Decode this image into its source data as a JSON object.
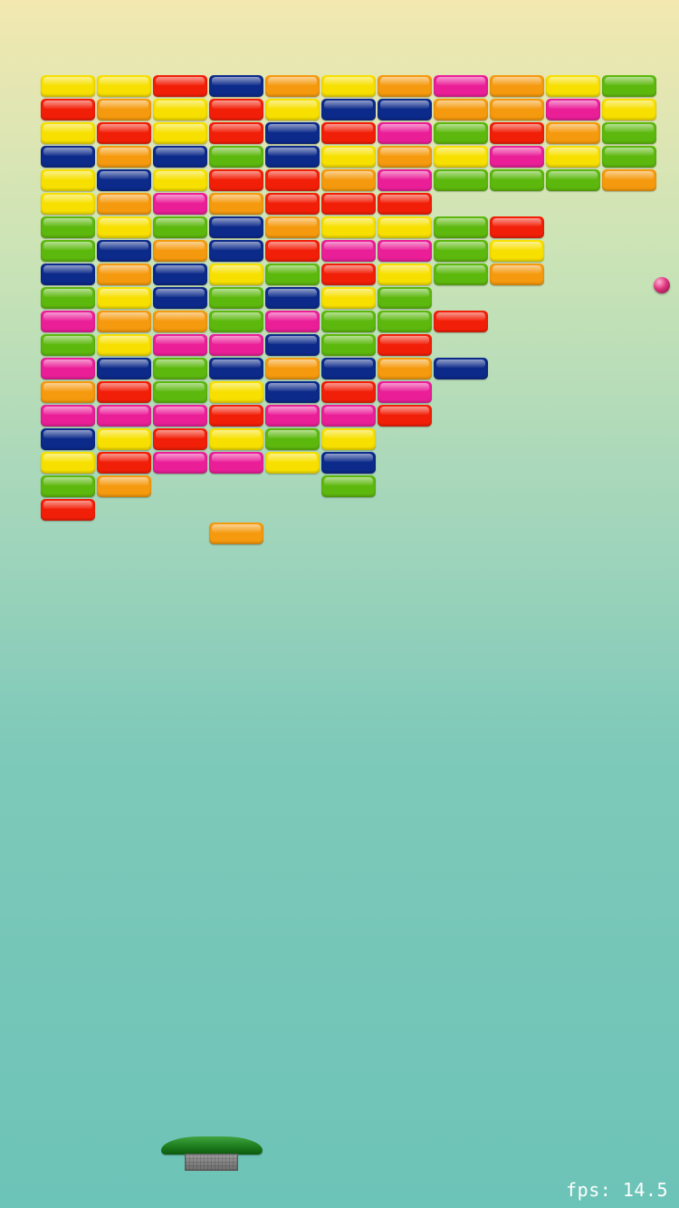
{
  "colors": {
    "yellow": "#f7e000",
    "orange": "#f59a0e",
    "red": "#f21f08",
    "navy": "#0c2a8a",
    "magenta": "#ea1f98",
    "green": "#5db80e"
  },
  "ball": {
    "color": "#e0357e",
    "icon": "ball-icon"
  },
  "paddle": {
    "color": "#1d7d1d",
    "icon": "paddle-icon"
  },
  "hud": {
    "fps_text": "fps: 14.5"
  },
  "bricks": {
    "columns": 11,
    "rows": [
      [
        "yellow",
        "yellow",
        "red",
        "navy",
        "orange",
        "yellow",
        "orange",
        "magenta",
        "orange",
        "yellow",
        "green"
      ],
      [
        "red",
        "orange",
        "yellow",
        "red",
        "yellow",
        "navy",
        "navy",
        "orange",
        "orange",
        "magenta",
        "yellow"
      ],
      [
        "yellow",
        "red",
        "yellow",
        "red",
        "navy",
        "red",
        "magenta",
        "green",
        "red",
        "orange",
        "green"
      ],
      [
        "navy",
        "orange",
        "navy",
        "green",
        "navy",
        "yellow",
        "orange",
        "yellow",
        "magenta",
        "yellow",
        "green"
      ],
      [
        "yellow",
        "navy",
        "yellow",
        "red",
        "red",
        "orange",
        "magenta",
        "green",
        "green",
        "green",
        "orange"
      ],
      [
        "yellow",
        "orange",
        "magenta",
        "orange",
        "red",
        "red",
        "red",
        null,
        null,
        null,
        null
      ],
      [
        "green",
        "yellow",
        "green",
        "navy",
        "orange",
        "yellow",
        "yellow",
        "green",
        "red",
        null,
        null
      ],
      [
        "green",
        "navy",
        "orange",
        "navy",
        "red",
        "magenta",
        "magenta",
        "green",
        "yellow",
        null,
        null
      ],
      [
        "navy",
        "orange",
        "navy",
        "yellow",
        "green",
        "red",
        "yellow",
        "green",
        "orange",
        null,
        null
      ],
      [
        "green",
        "yellow",
        "navy",
        "green",
        "navy",
        "yellow",
        "green",
        null,
        null,
        null,
        null
      ],
      [
        "magenta",
        "orange",
        "orange",
        "green",
        "magenta",
        "green",
        "green",
        "red",
        null,
        null,
        null
      ],
      [
        "green",
        "yellow",
        "magenta",
        "magenta",
        "navy",
        "green",
        "red",
        null,
        null,
        null,
        null
      ],
      [
        "magenta",
        "navy",
        "green",
        "navy",
        "orange",
        "navy",
        "orange",
        "navy",
        null,
        null,
        null
      ],
      [
        "orange",
        "red",
        "green",
        "yellow",
        "navy",
        "red",
        "magenta",
        null,
        null,
        null,
        null
      ],
      [
        "magenta",
        "magenta",
        "magenta",
        "red",
        "magenta",
        "magenta",
        "red",
        null,
        null,
        null,
        null
      ],
      [
        "navy",
        "yellow",
        "red",
        "yellow",
        "green",
        "yellow",
        null,
        null,
        null,
        null,
        null
      ],
      [
        "yellow",
        "red",
        "magenta",
        "magenta",
        "yellow",
        "navy",
        null,
        null,
        null,
        null,
        null
      ],
      [
        "green",
        "orange",
        null,
        null,
        null,
        "green",
        null,
        null,
        null,
        null,
        null
      ],
      [
        "red",
        null,
        null,
        null,
        null,
        null,
        null,
        null,
        null,
        null,
        null
      ],
      [
        null,
        null,
        null,
        "orange",
        null,
        null,
        null,
        null,
        null,
        null,
        null
      ]
    ]
  }
}
